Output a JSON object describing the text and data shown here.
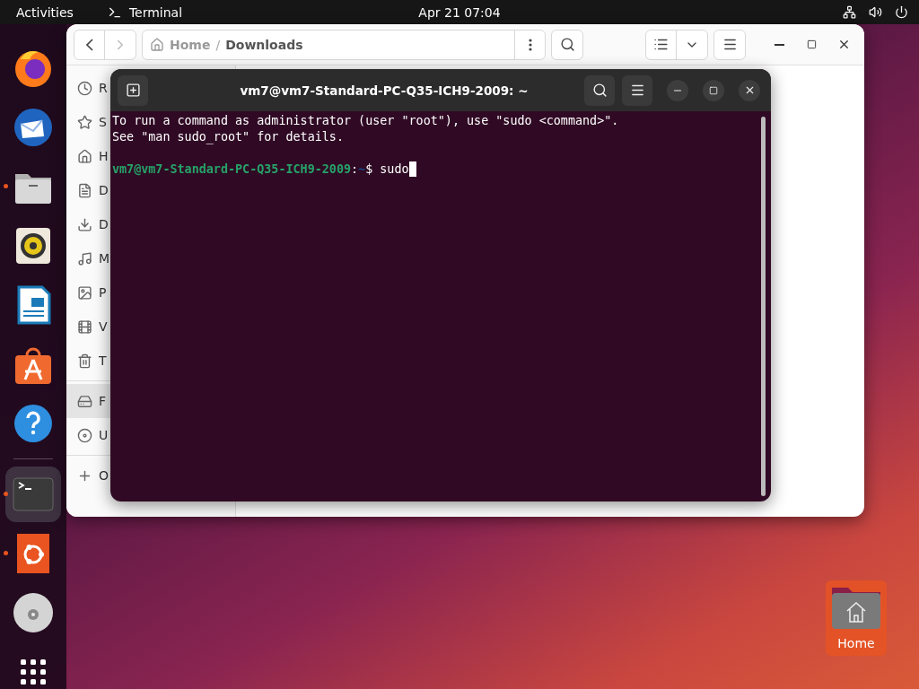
{
  "top_bar": {
    "activities": "Activities",
    "app": "Terminal",
    "clock": "Apr 21  07:04"
  },
  "dock": [
    {
      "kind": "firefox",
      "running": false,
      "selected": false
    },
    {
      "kind": "mail",
      "running": false,
      "selected": false
    },
    {
      "kind": "files",
      "running": true,
      "selected": false
    },
    {
      "kind": "music",
      "running": false,
      "selected": false
    },
    {
      "kind": "writer",
      "running": false,
      "selected": false
    },
    {
      "kind": "store",
      "running": false,
      "selected": false
    },
    {
      "kind": "help",
      "running": false,
      "selected": false
    },
    {
      "kind": "separator"
    },
    {
      "kind": "terminal",
      "running": true,
      "selected": true
    },
    {
      "kind": "ubuntu",
      "running": true,
      "selected": false
    },
    {
      "kind": "disc",
      "running": false,
      "selected": false
    },
    {
      "kind": "apps",
      "running": false,
      "selected": false
    }
  ],
  "file_manager": {
    "path": [
      "Home",
      "Downloads"
    ],
    "path_separator": "/",
    "sidebar": [
      {
        "items": [
          {
            "kind": "recent",
            "label": "R",
            "selected": false
          },
          {
            "kind": "star",
            "label": "S",
            "selected": false
          },
          {
            "kind": "home",
            "label": "H",
            "selected": false
          },
          {
            "kind": "document",
            "label": "D",
            "selected": false
          },
          {
            "kind": "download",
            "label": "D",
            "selected": false
          },
          {
            "kind": "music",
            "label": "M",
            "selected": false
          },
          {
            "kind": "picture",
            "label": "P",
            "selected": false
          },
          {
            "kind": "video",
            "label": "V",
            "selected": false
          },
          {
            "kind": "trash",
            "label": "T",
            "selected": false
          }
        ]
      },
      {
        "items": [
          {
            "kind": "drive",
            "label": "F",
            "selected": true
          },
          {
            "kind": "disc",
            "label": "U",
            "selected": false
          }
        ]
      },
      {
        "items": [
          {
            "kind": "plus",
            "label": "O",
            "selected": false
          }
        ]
      }
    ]
  },
  "terminal": {
    "title": "vm7@vm7-Standard-PC-Q35-ICH9-2009: ~",
    "lines": [
      "To run a command as administrator (user \"root\"), use \"sudo <command>\".",
      "See \"man sudo_root\" for details."
    ],
    "prompt": {
      "user_host": "vm7@vm7-Standard-PC-Q35-ICH9-2009",
      "separator": ":",
      "directory": "~",
      "symbol": "$",
      "command": "sudo"
    }
  },
  "desktop_icons": [
    {
      "label": "Home",
      "selected": true
    }
  ]
}
